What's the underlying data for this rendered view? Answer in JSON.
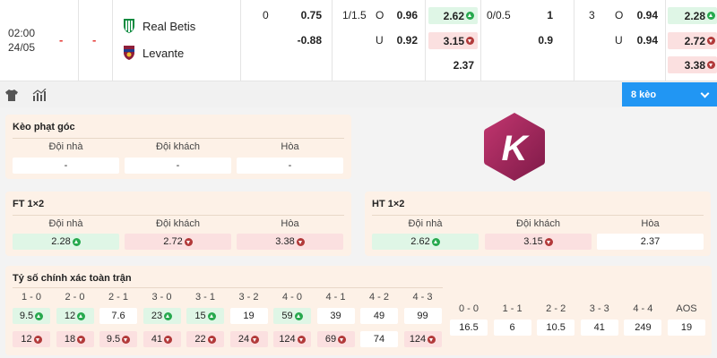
{
  "match": {
    "time": "02:00",
    "date": "24/05",
    "score_home": "-",
    "score_away": "-",
    "home_team": "Real Betis",
    "away_team": "Levante",
    "home_crest_color": "#0b8a3e",
    "away_crest_color": "#8e1f3a",
    "handicap_ft": {
      "line": "0",
      "home": "0.75",
      "away": "-0.88"
    },
    "ou_ft": {
      "line": "1/1.5",
      "over_label": "O",
      "over": "0.96",
      "under_label": "U",
      "under": "0.92"
    },
    "x12_ft": {
      "home": "2.62",
      "away": "3.15",
      "draw": "2.37"
    },
    "handicap_ht": {
      "line": "0/0.5",
      "home": "1",
      "away": "0.9"
    },
    "ou_ht": {
      "line": "3",
      "over_label": "O",
      "over": "0.94",
      "under_label": "U",
      "under": "0.94"
    },
    "x12_ht": {
      "home": "2.28",
      "away": "2.72",
      "draw": "3.38"
    }
  },
  "toolbar": {
    "keo_label": "8 kèo"
  },
  "corner": {
    "title": "Kèo phạt góc",
    "headers": [
      "Đội nhà",
      "Đội khách",
      "Hòa"
    ],
    "values": [
      "-",
      "-",
      "-"
    ]
  },
  "ft12": {
    "title": "FT 1×2",
    "headers": [
      "Đội nhà",
      "Đội khách",
      "Hòa"
    ],
    "values": [
      "2.28",
      "2.72",
      "3.38"
    ]
  },
  "ht12": {
    "title": "HT 1×2",
    "headers": [
      "Đội nhà",
      "Đội khách",
      "Hòa"
    ],
    "values": [
      "2.62",
      "3.15",
      "2.37"
    ]
  },
  "correct_score": {
    "title": "Tỷ số chính xác toàn trận",
    "left_scores": [
      "1 - 0",
      "2 - 0",
      "2 - 1",
      "3 - 0",
      "3 - 1",
      "3 - 2",
      "4 - 0",
      "4 - 1",
      "4 - 2",
      "4 - 3"
    ],
    "home_values": [
      "9.5",
      "12",
      "7.6",
      "23",
      "15",
      "19",
      "59",
      "39",
      "49",
      "99"
    ],
    "away_values": [
      "12",
      "18",
      "9.5",
      "41",
      "22",
      "24",
      "124",
      "69",
      "74",
      "124"
    ],
    "right_scores": [
      "0 - 0",
      "1 - 1",
      "2 - 2",
      "3 - 3",
      "4 - 4",
      "AOS"
    ],
    "right_values": [
      "16.5",
      "6",
      "10.5",
      "41",
      "249",
      "19"
    ]
  },
  "logo_letter": "K",
  "colors": {
    "accent": "#2196f3",
    "up": "#27a94e",
    "down": "#b23a3a",
    "logo": "#a4275c"
  }
}
